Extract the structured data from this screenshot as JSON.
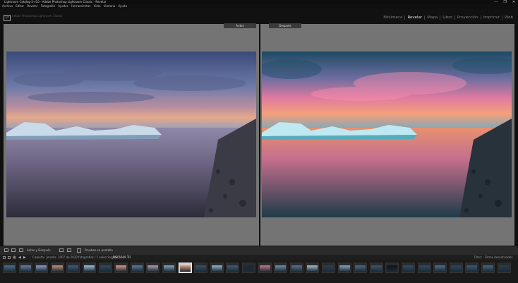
{
  "window": {
    "title": "Lightroom Catalog-2-v10 - Adobe Photoshop Lightroom Classic - Revelar",
    "controls": [
      "—",
      "❐",
      "✕"
    ]
  },
  "menu": [
    "Archivo",
    "Editar",
    "Revelar",
    "Fotografía",
    "Ajustes",
    "Herramientas",
    "Vista",
    "Ventana",
    "Ayuda"
  ],
  "identity": {
    "logo": "Lr",
    "subtitle": "Adobe Photoshop Lightroom Classic"
  },
  "modules": [
    {
      "label": "Biblioteca",
      "active": false
    },
    {
      "label": "Revelar",
      "active": true
    },
    {
      "label": "Mapa",
      "active": false
    },
    {
      "label": "Libro",
      "active": false
    },
    {
      "label": "Proyección",
      "active": false
    },
    {
      "label": "Imprimir",
      "active": false
    },
    {
      "label": "Web",
      "active": false
    }
  ],
  "compare": {
    "before_label": "Antes",
    "after_label": "Después"
  },
  "toolbar": {
    "mode_label": "Antes y Después",
    "proof_label": "Pruebas en pantalla"
  },
  "filmstrip_header": {
    "source": "Carpeta : Jorodia",
    "count": "1007 de 2020 fotografías / 1 seleccionada /",
    "filename": "_DSC6609.TIF",
    "filter_label": "Filtro:",
    "filter_value": "Filtros desactivados"
  },
  "filmstrip": {
    "thumbnail_count": 32,
    "selected_index": 11
  },
  "colors": {
    "panel_gray": "#747474",
    "active_module": "#e6e6e6",
    "inactive_module": "#7f7f7f"
  }
}
